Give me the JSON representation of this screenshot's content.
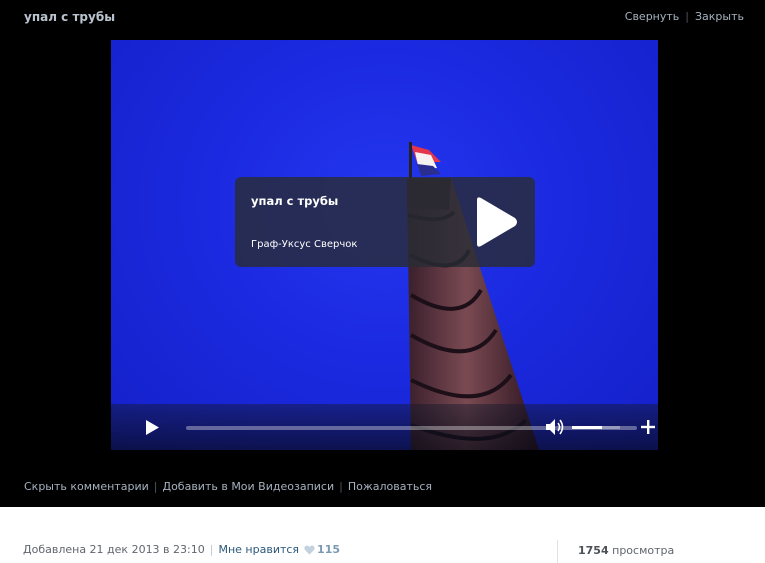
{
  "window": {
    "title": "упал с трубы",
    "actions": {
      "minimize_label": "Свернуть",
      "close_label": "Закрыть"
    }
  },
  "player": {
    "overlay": {
      "title": "упал с трубы",
      "author": "Граф-Уксус Сверчок"
    },
    "progress_fraction": 0.0,
    "volume_fraction": 0.62
  },
  "links": {
    "hide_comments": "Скрыть комментарии",
    "add_to_videos": "Добавить в Мои Видеозаписи",
    "report": "Пожаловаться"
  },
  "info": {
    "added": "Добавлена 21 дек 2013 в 23:10",
    "like_label": "Мне нравится",
    "like_count": "115",
    "views_count": "1754",
    "views_label": "просмотра"
  },
  "icons": [
    "play-icon",
    "volume-icon",
    "plus-icon",
    "loop-icon",
    "fullscreen-icon",
    "heart-icon"
  ],
  "colors": {
    "dark_bg": "#000000",
    "sky": "#1b2ae0",
    "link_blue": "#2b587a",
    "muted_link": "#a6b2bf"
  }
}
